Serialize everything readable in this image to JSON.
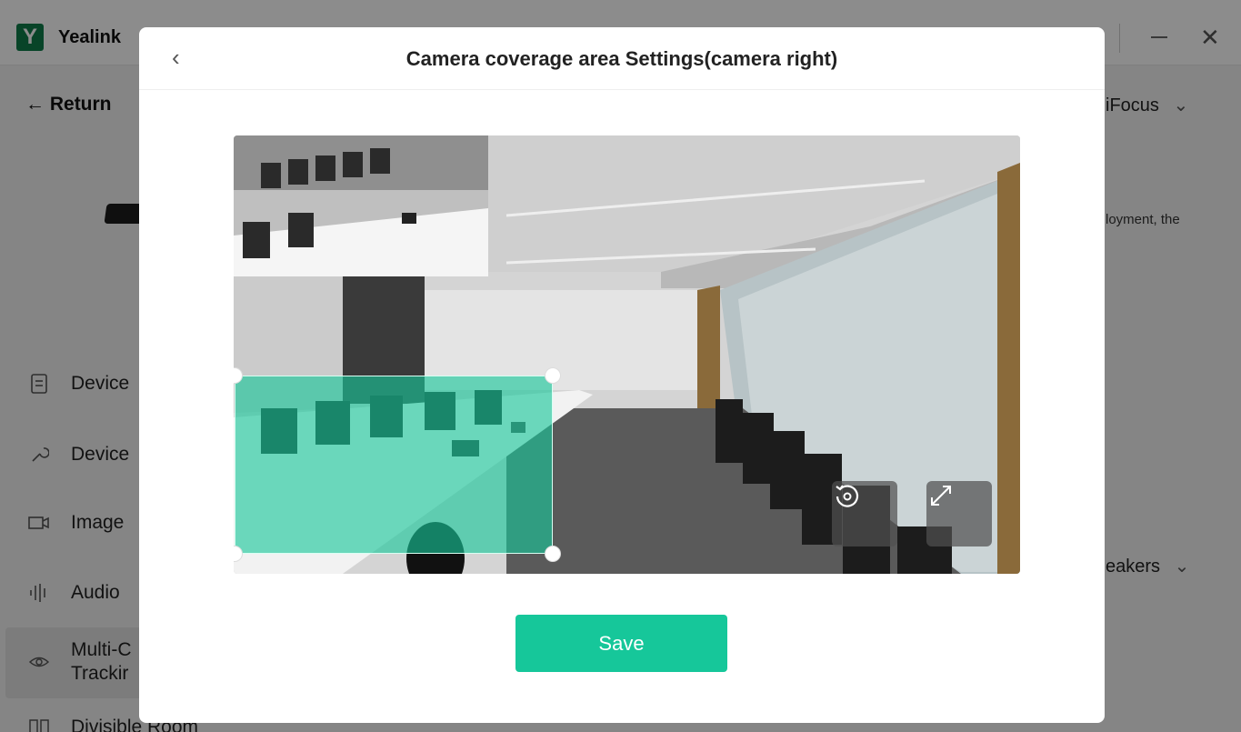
{
  "app": {
    "logo_letter": "Y",
    "name": "Yealink",
    "return_label": "Return",
    "nav": [
      {
        "label": "Device",
        "icon": "document-icon"
      },
      {
        "label": "Device",
        "icon": "wrench-icon"
      },
      {
        "label": "Image",
        "icon": "camera-icon"
      },
      {
        "label": "Audio",
        "icon": "audio-wave-icon"
      },
      {
        "label": "Multi-C",
        "label2": "Trackir",
        "icon": "eye-icon"
      },
      {
        "label": "Divisible Room",
        "icon": "room-divide-icon"
      }
    ],
    "right_heading": "iFocus",
    "right_text": "loyment, the",
    "right_heading2": "eakers"
  },
  "modal": {
    "title": "Camera coverage area Settings(camera right)",
    "back_icon": "chevron-left-icon",
    "reset_icon": "reset-icon",
    "fullscreen_icon": "expand-icon",
    "save_label": "Save"
  },
  "colors": {
    "accent": "#16c79a",
    "zone_fill": "#16c79a",
    "overlay": "rgba(0,0,0,0.45)"
  }
}
